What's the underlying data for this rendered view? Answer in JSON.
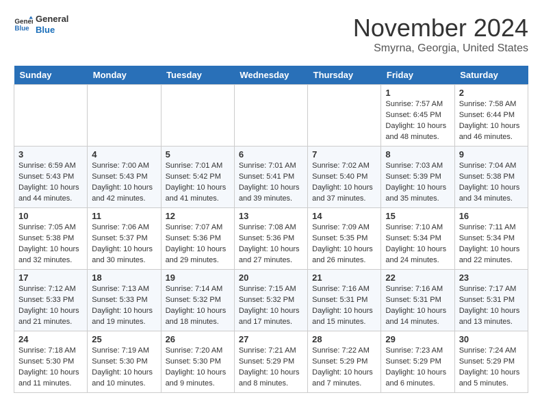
{
  "header": {
    "logo_line1": "General",
    "logo_line2": "Blue",
    "month": "November 2024",
    "location": "Smyrna, Georgia, United States"
  },
  "weekdays": [
    "Sunday",
    "Monday",
    "Tuesday",
    "Wednesday",
    "Thursday",
    "Friday",
    "Saturday"
  ],
  "weeks": [
    [
      {
        "day": "",
        "info": ""
      },
      {
        "day": "",
        "info": ""
      },
      {
        "day": "",
        "info": ""
      },
      {
        "day": "",
        "info": ""
      },
      {
        "day": "",
        "info": ""
      },
      {
        "day": "1",
        "info": "Sunrise: 7:57 AM\nSunset: 6:45 PM\nDaylight: 10 hours\nand 48 minutes."
      },
      {
        "day": "2",
        "info": "Sunrise: 7:58 AM\nSunset: 6:44 PM\nDaylight: 10 hours\nand 46 minutes."
      }
    ],
    [
      {
        "day": "3",
        "info": "Sunrise: 6:59 AM\nSunset: 5:43 PM\nDaylight: 10 hours\nand 44 minutes."
      },
      {
        "day": "4",
        "info": "Sunrise: 7:00 AM\nSunset: 5:43 PM\nDaylight: 10 hours\nand 42 minutes."
      },
      {
        "day": "5",
        "info": "Sunrise: 7:01 AM\nSunset: 5:42 PM\nDaylight: 10 hours\nand 41 minutes."
      },
      {
        "day": "6",
        "info": "Sunrise: 7:01 AM\nSunset: 5:41 PM\nDaylight: 10 hours\nand 39 minutes."
      },
      {
        "day": "7",
        "info": "Sunrise: 7:02 AM\nSunset: 5:40 PM\nDaylight: 10 hours\nand 37 minutes."
      },
      {
        "day": "8",
        "info": "Sunrise: 7:03 AM\nSunset: 5:39 PM\nDaylight: 10 hours\nand 35 minutes."
      },
      {
        "day": "9",
        "info": "Sunrise: 7:04 AM\nSunset: 5:38 PM\nDaylight: 10 hours\nand 34 minutes."
      }
    ],
    [
      {
        "day": "10",
        "info": "Sunrise: 7:05 AM\nSunset: 5:38 PM\nDaylight: 10 hours\nand 32 minutes."
      },
      {
        "day": "11",
        "info": "Sunrise: 7:06 AM\nSunset: 5:37 PM\nDaylight: 10 hours\nand 30 minutes."
      },
      {
        "day": "12",
        "info": "Sunrise: 7:07 AM\nSunset: 5:36 PM\nDaylight: 10 hours\nand 29 minutes."
      },
      {
        "day": "13",
        "info": "Sunrise: 7:08 AM\nSunset: 5:36 PM\nDaylight: 10 hours\nand 27 minutes."
      },
      {
        "day": "14",
        "info": "Sunrise: 7:09 AM\nSunset: 5:35 PM\nDaylight: 10 hours\nand 26 minutes."
      },
      {
        "day": "15",
        "info": "Sunrise: 7:10 AM\nSunset: 5:34 PM\nDaylight: 10 hours\nand 24 minutes."
      },
      {
        "day": "16",
        "info": "Sunrise: 7:11 AM\nSunset: 5:34 PM\nDaylight: 10 hours\nand 22 minutes."
      }
    ],
    [
      {
        "day": "17",
        "info": "Sunrise: 7:12 AM\nSunset: 5:33 PM\nDaylight: 10 hours\nand 21 minutes."
      },
      {
        "day": "18",
        "info": "Sunrise: 7:13 AM\nSunset: 5:33 PM\nDaylight: 10 hours\nand 19 minutes."
      },
      {
        "day": "19",
        "info": "Sunrise: 7:14 AM\nSunset: 5:32 PM\nDaylight: 10 hours\nand 18 minutes."
      },
      {
        "day": "20",
        "info": "Sunrise: 7:15 AM\nSunset: 5:32 PM\nDaylight: 10 hours\nand 17 minutes."
      },
      {
        "day": "21",
        "info": "Sunrise: 7:16 AM\nSunset: 5:31 PM\nDaylight: 10 hours\nand 15 minutes."
      },
      {
        "day": "22",
        "info": "Sunrise: 7:16 AM\nSunset: 5:31 PM\nDaylight: 10 hours\nand 14 minutes."
      },
      {
        "day": "23",
        "info": "Sunrise: 7:17 AM\nSunset: 5:31 PM\nDaylight: 10 hours\nand 13 minutes."
      }
    ],
    [
      {
        "day": "24",
        "info": "Sunrise: 7:18 AM\nSunset: 5:30 PM\nDaylight: 10 hours\nand 11 minutes."
      },
      {
        "day": "25",
        "info": "Sunrise: 7:19 AM\nSunset: 5:30 PM\nDaylight: 10 hours\nand 10 minutes."
      },
      {
        "day": "26",
        "info": "Sunrise: 7:20 AM\nSunset: 5:30 PM\nDaylight: 10 hours\nand 9 minutes."
      },
      {
        "day": "27",
        "info": "Sunrise: 7:21 AM\nSunset: 5:29 PM\nDaylight: 10 hours\nand 8 minutes."
      },
      {
        "day": "28",
        "info": "Sunrise: 7:22 AM\nSunset: 5:29 PM\nDaylight: 10 hours\nand 7 minutes."
      },
      {
        "day": "29",
        "info": "Sunrise: 7:23 AM\nSunset: 5:29 PM\nDaylight: 10 hours\nand 6 minutes."
      },
      {
        "day": "30",
        "info": "Sunrise: 7:24 AM\nSunset: 5:29 PM\nDaylight: 10 hours\nand 5 minutes."
      }
    ]
  ]
}
